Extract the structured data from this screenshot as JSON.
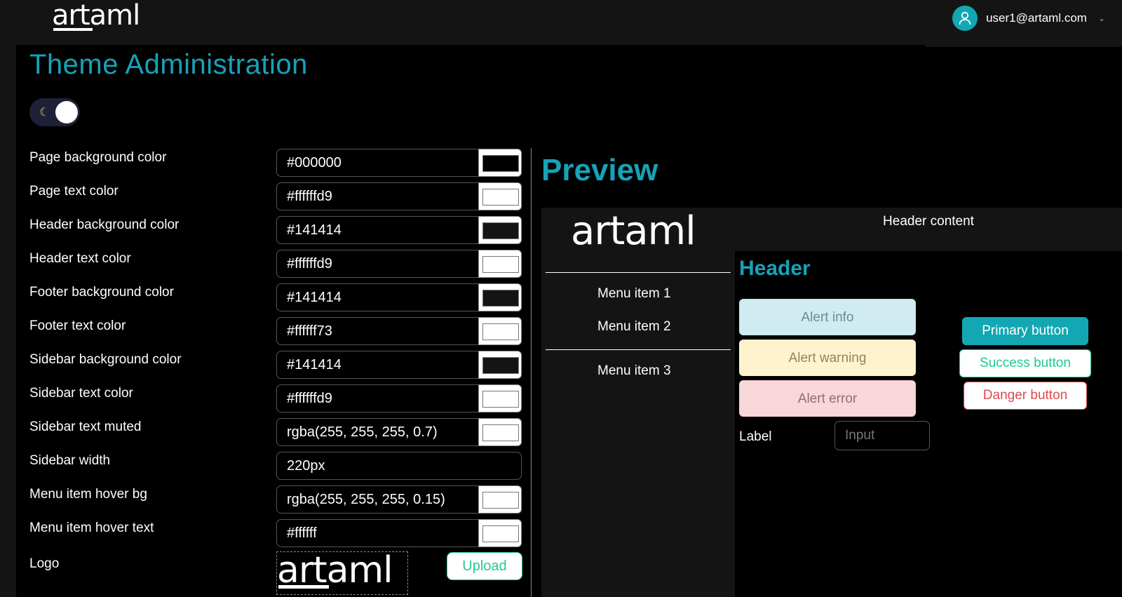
{
  "app": {
    "logo": "artaml",
    "user_email": "user1@artaml.com"
  },
  "page": {
    "title": "Theme Administration",
    "toggle_icon": "moon-icon"
  },
  "fields": [
    {
      "label": "Page background color",
      "value": "#000000",
      "swatch": "#000000"
    },
    {
      "label": "Page text color",
      "value": "#ffffffd9",
      "swatch": "#ffffff"
    },
    {
      "label": "Header background color",
      "value": "#141414",
      "swatch": "#141414"
    },
    {
      "label": "Header text color",
      "value": "#ffffffd9",
      "swatch": "#ffffff"
    },
    {
      "label": "Footer background color",
      "value": "#141414",
      "swatch": "#141414"
    },
    {
      "label": "Footer text color",
      "value": "#ffffff73",
      "swatch": "#ffffff"
    },
    {
      "label": "Sidebar background color",
      "value": "#141414",
      "swatch": "#141414"
    },
    {
      "label": "Sidebar text color",
      "value": "#ffffffd9",
      "swatch": "#ffffff"
    },
    {
      "label": "Sidebar text muted",
      "value": "rgba(255, 255, 255, 0.7)",
      "swatch": "#ffffff"
    },
    {
      "label": "Sidebar width",
      "value": "220px"
    },
    {
      "label": "Menu item hover bg",
      "value": "rgba(255, 255, 255, 0.15)",
      "swatch": "#ffffff"
    },
    {
      "label": "Menu item hover text",
      "value": "#ffffff",
      "swatch": "#ffffff"
    }
  ],
  "logo_field": {
    "label": "Logo",
    "upload_label": "Upload"
  },
  "preview": {
    "title": "Preview",
    "header_content": "Header content",
    "menu_items": [
      "Menu item 1",
      "Menu item 2",
      "Menu item 3"
    ],
    "heading": "Header",
    "alerts": {
      "info": "Alert info",
      "warning": "Alert warning",
      "error": "Alert error"
    },
    "label": "Label",
    "input_placeholder": "Input",
    "buttons": {
      "primary": "Primary button",
      "success": "Success button",
      "danger": "Danger button"
    }
  },
  "colors": {
    "accent": "#17a2b8",
    "primary": "#12a7b3",
    "success": "#20c997",
    "danger": "#e04a4a"
  }
}
